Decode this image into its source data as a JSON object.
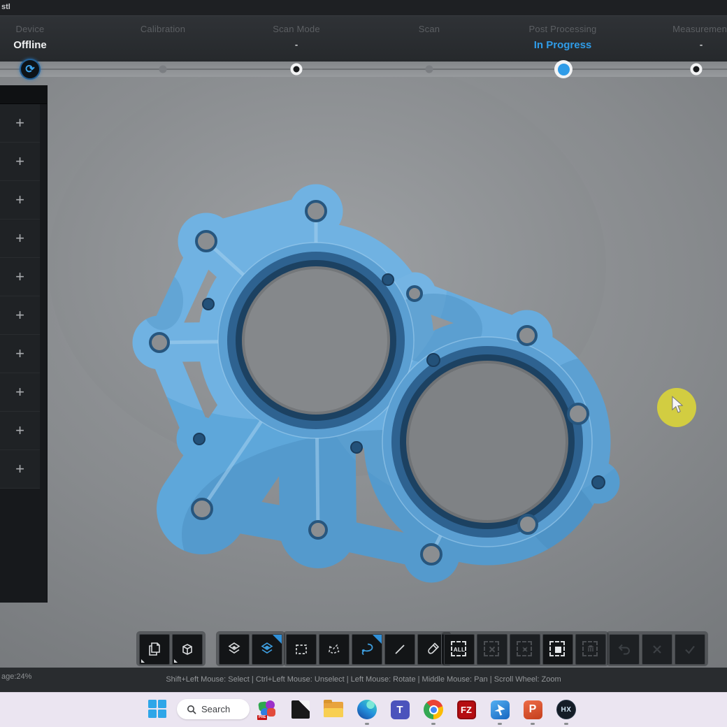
{
  "titlebar": {
    "filename": "stl"
  },
  "workflow": {
    "steps": [
      {
        "label": "Device",
        "status": "Offline",
        "state": "done"
      },
      {
        "label": "Calibration",
        "status": "",
        "state": "pending"
      },
      {
        "label": "Scan Mode",
        "status": "-",
        "state": "done"
      },
      {
        "label": "Scan",
        "status": "",
        "state": "pending"
      },
      {
        "label": "Post Processing",
        "status": "In Progress",
        "state": "current"
      },
      {
        "label": "Measurement",
        "status": "-",
        "state": "upcoming"
      }
    ]
  },
  "sidebar": {
    "items": [
      {
        "label": "+"
      },
      {
        "label": "+"
      },
      {
        "label": "+"
      },
      {
        "label": "+"
      },
      {
        "label": "+"
      },
      {
        "label": "+"
      },
      {
        "label": "+"
      },
      {
        "label": "+"
      },
      {
        "label": "+"
      },
      {
        "label": "+"
      }
    ]
  },
  "toolbar": {
    "select_all_label": "ALL",
    "groups": [
      {
        "buttons": [
          "copy-mesh",
          "clip-box"
        ]
      },
      {
        "buttons": [
          "overlap-regions",
          "overlap-regions-active"
        ]
      },
      {
        "buttons": [
          "rect-select",
          "polygon-select",
          "lasso-select-active",
          "line-select",
          "brush-select"
        ]
      },
      {
        "buttons": [
          "select-all",
          "unselect-all",
          "invert-selection",
          "select-connected",
          "delete-selected"
        ]
      },
      {
        "buttons": [
          "undo",
          "cancel",
          "confirm"
        ]
      }
    ]
  },
  "status_bar": {
    "left": "age:24%",
    "hints": "Shift+Left Mouse: Select | Ctrl+Left Mouse: Unselect | Left Mouse: Rotate | Middle Mouse: Pan | Scroll Wheel: Zoom"
  },
  "taskbar": {
    "search_label": "Search",
    "apps": [
      {
        "name": "colorful-app",
        "glyph": "PRE",
        "running": false
      },
      {
        "name": "photos-app",
        "glyph": "",
        "running": false
      },
      {
        "name": "file-explorer",
        "glyph": "",
        "running": false
      },
      {
        "name": "edge",
        "glyph": "",
        "running": true
      },
      {
        "name": "teams",
        "glyph": "T",
        "running": false
      },
      {
        "name": "chrome",
        "glyph": "",
        "running": true
      },
      {
        "name": "filezilla",
        "glyph": "FZ",
        "running": false
      },
      {
        "name": "pointer-app",
        "glyph": "",
        "running": true
      },
      {
        "name": "powerpoint",
        "glyph": "P",
        "running": true
      },
      {
        "name": "exscan-hx",
        "glyph": "HX",
        "running": true
      }
    ]
  },
  "viewport": {
    "model": "scanned gear housing cover mesh",
    "mesh_color": "#5ea7da",
    "accent_blue": "#2f9ce8",
    "cursor_highlight_color": "#d8d33c"
  }
}
